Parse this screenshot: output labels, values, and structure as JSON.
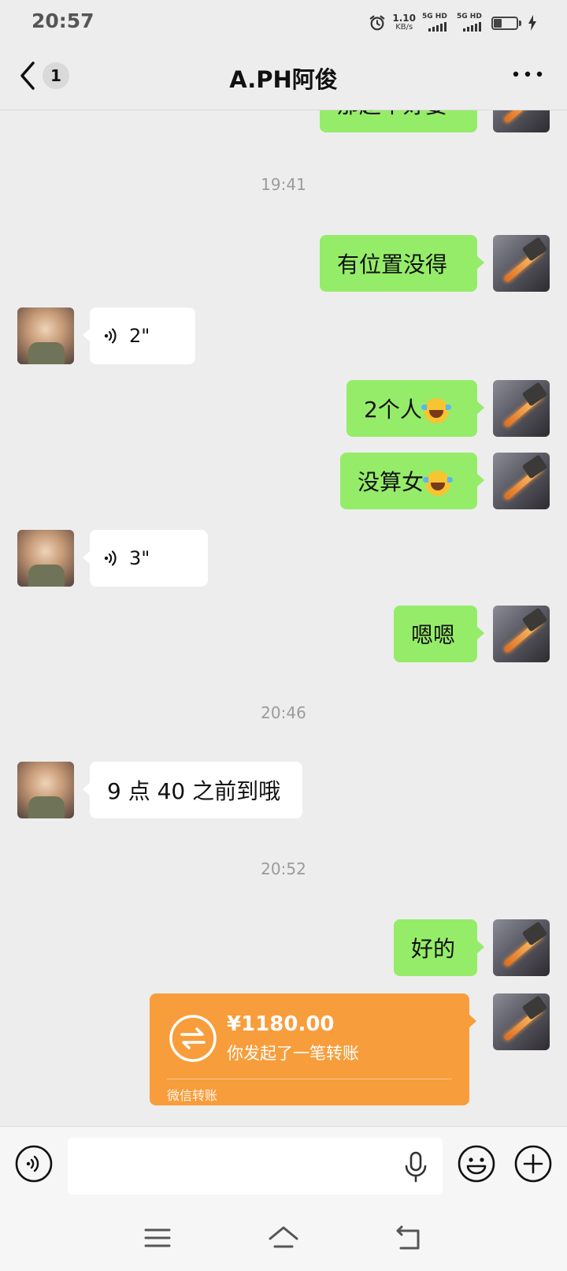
{
  "status_bar": {
    "time": "20:57",
    "net_speed_value": "1.10",
    "net_speed_unit": "KB/s",
    "sim1": "5G HD",
    "sim2": "5G HD",
    "battery_level": 0.35
  },
  "header": {
    "unread_count": "1",
    "title": "A.PH阿俊"
  },
  "chat": {
    "partial_message": "那赵个好要",
    "timestamps": [
      "19:41",
      "20:46",
      "20:52"
    ],
    "messages": [
      {
        "sender": "me",
        "text": "有位置没得"
      },
      {
        "sender": "other",
        "type": "voice",
        "duration": "2\""
      },
      {
        "sender": "me",
        "text": "2个人",
        "emoji": "crying-laughing-emoji"
      },
      {
        "sender": "me",
        "text": "没算女",
        "emoji": "crying-laughing-emoji"
      },
      {
        "sender": "other",
        "type": "voice",
        "duration": "3\""
      },
      {
        "sender": "me",
        "text": "嗯嗯"
      },
      {
        "sender": "other",
        "text": "9 点 40 之前到哦"
      },
      {
        "sender": "me",
        "text": "好的"
      }
    ],
    "transfer": {
      "amount": "¥1180.00",
      "description": "你发起了一笔转账",
      "footer": "微信转账",
      "color": "#f89d3b"
    }
  },
  "input_bar": {
    "value": "",
    "placeholder": ""
  },
  "colors": {
    "my_bubble": "#95ec69",
    "other_bubble": "#ffffff",
    "background": "#ededed"
  }
}
